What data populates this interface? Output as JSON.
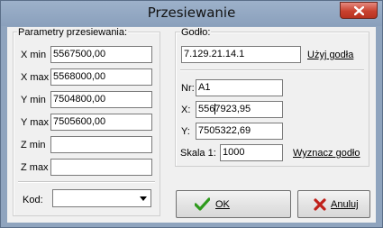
{
  "window": {
    "title": "Przesiewanie"
  },
  "params": {
    "group_label": "Parametry przesiewania:",
    "x_min": {
      "label": "X min",
      "value": "5567500,00"
    },
    "x_max": {
      "label": "X max",
      "value": "5568000,00"
    },
    "y_min": {
      "label": "Y min",
      "value": "7504800,00"
    },
    "y_max": {
      "label": "Y max",
      "value": "7505600,00"
    },
    "z_min": {
      "label": "Z min",
      "value": ""
    },
    "z_max": {
      "label": "Z max",
      "value": ""
    },
    "kod": {
      "label": "Kod:",
      "value": ""
    }
  },
  "godlo": {
    "group_label": "Godło:",
    "value": "7.129.21.14.1",
    "use_label": "Użyj godła",
    "nr": {
      "label": "Nr:",
      "value": "A1"
    },
    "x": {
      "label": "X:",
      "value": "5567923,95"
    },
    "y": {
      "label": "Y:",
      "value": "7505322,69"
    },
    "skala": {
      "label": "Skala 1:",
      "value": "1000"
    },
    "wyznacz_label": "Wyznacz godło"
  },
  "buttons": {
    "ok": "OK",
    "cancel": "Anuluj"
  },
  "icons": {
    "close": "close-icon",
    "ok": "checkmark-icon",
    "cancel": "x-mark-icon",
    "dropdown": "chevron-down-icon"
  },
  "colors": {
    "ok_icon": "#2e9a1c",
    "cancel_icon": "#c0201a",
    "close_button": "#c8412f"
  }
}
